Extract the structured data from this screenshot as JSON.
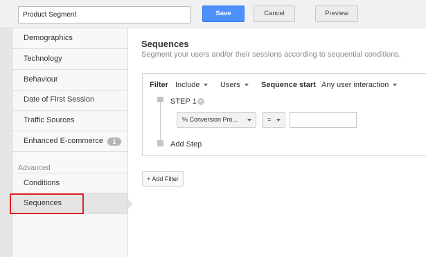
{
  "toolbar": {
    "segment_name": "Product Segment",
    "save_label": "Save",
    "cancel_label": "Cancel",
    "preview_label": "Preview"
  },
  "sidebar": {
    "items": [
      {
        "label": "Demographics"
      },
      {
        "label": "Technology"
      },
      {
        "label": "Behaviour"
      },
      {
        "label": "Date of First Session"
      },
      {
        "label": "Traffic Sources"
      },
      {
        "label": "Enhanced E-commerce",
        "badge": "1"
      }
    ],
    "advanced_label": "Advanced",
    "advanced_items": [
      {
        "label": "Conditions"
      },
      {
        "label": "Sequences",
        "active": true
      }
    ]
  },
  "main": {
    "title": "Sequences",
    "subtitle": "Segment your users and/or their sessions according to sequential conditions.",
    "filter": {
      "label": "Filter",
      "include": "Include",
      "scope": "Users",
      "sequence_start_label": "Sequence start",
      "sequence_start_value": "Any user interaction",
      "step_label": "STEP 1",
      "step_remove": "×",
      "metric": "% Conversion Pro...",
      "operator": "=",
      "value": "",
      "add_step_label": "Add Step"
    },
    "add_filter_label": "+ Add Filter"
  },
  "colors": {
    "primary_button": "#4d90fe",
    "highlight_box": "#e02020"
  }
}
